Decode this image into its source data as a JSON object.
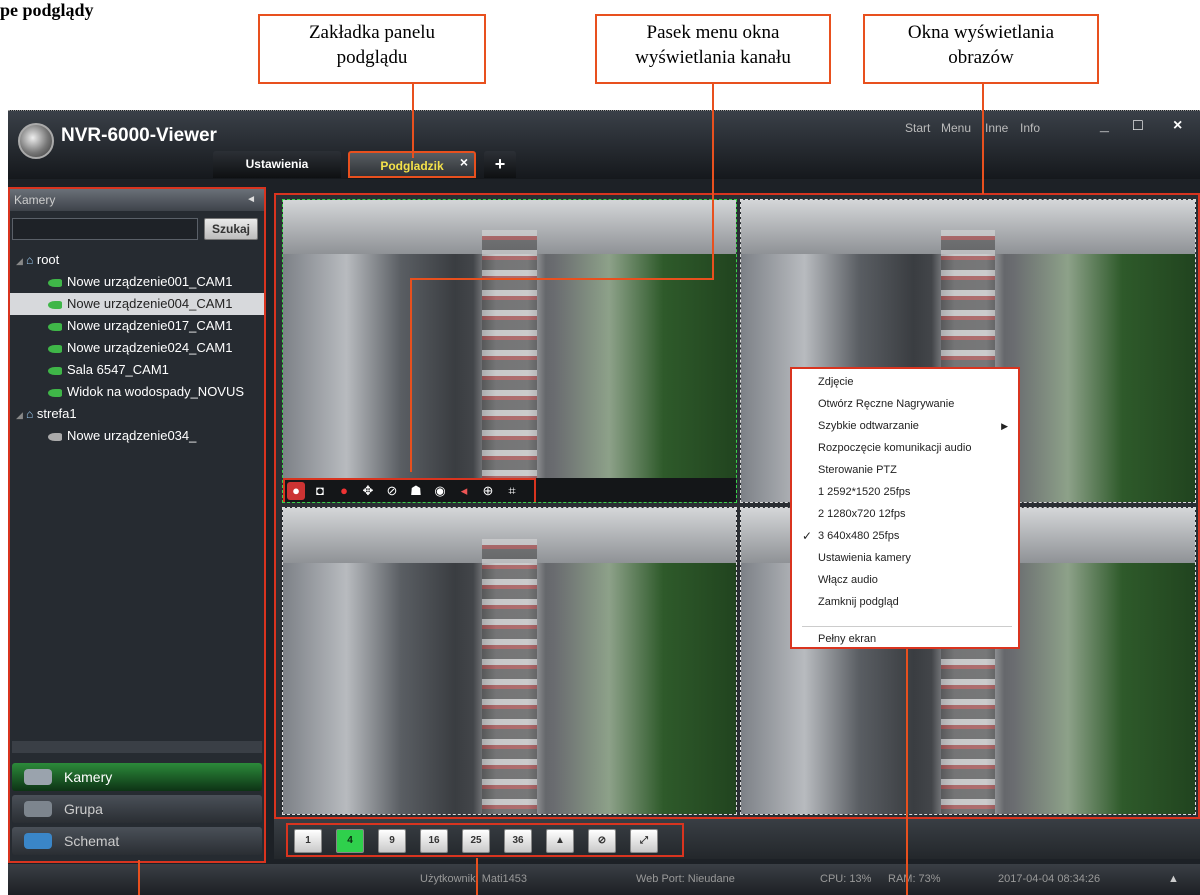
{
  "heading": "pe podglądy",
  "callouts": {
    "tab_panel": [
      "Zakładka panelu",
      "podglądu"
    ],
    "menu_bar": [
      "Pasek menu okna",
      "wyświetlania kanału"
    ],
    "display_windows": [
      "Okna wyświetlania",
      "obrazów"
    ]
  },
  "app": {
    "title": "NVR-6000-Viewer",
    "top_menu": [
      "Start",
      "Menu",
      "Inne",
      "Info"
    ],
    "window_buttons": [
      "_",
      "□",
      "×"
    ],
    "tabs": [
      {
        "label": "Ustawienia",
        "active": false
      },
      {
        "label": "Podgladzik",
        "active": true,
        "close": "×"
      }
    ],
    "add_tab": "+"
  },
  "sidebar": {
    "header": "Kamery",
    "collapse_icon": "◄",
    "search": {
      "value": "",
      "button": "Szukaj"
    },
    "tree": [
      {
        "label": "root",
        "type": "group"
      },
      {
        "label": "Nowe urządzenie001_CAM1",
        "type": "camera",
        "online": true,
        "selected": false
      },
      {
        "label": "Nowe urządzenie004_CAM1",
        "type": "camera",
        "online": true,
        "selected": true
      },
      {
        "label": "Nowe urządzenie017_CAM1",
        "type": "camera",
        "online": true,
        "selected": false
      },
      {
        "label": "Nowe urządzenie024_CAM1",
        "type": "camera",
        "online": true,
        "selected": false
      },
      {
        "label": "Sala 6547_CAM1",
        "type": "camera",
        "online": true,
        "selected": false
      },
      {
        "label": "Widok na wodospady_NOVUS",
        "type": "camera",
        "online": true,
        "selected": false
      },
      {
        "label": "strefa1",
        "type": "group"
      },
      {
        "label": "Nowe urządzenie034_",
        "type": "camera",
        "online": false,
        "selected": false
      }
    ],
    "nav": [
      {
        "label": "Kamery",
        "active": true
      },
      {
        "label": "Grupa",
        "active": false
      },
      {
        "label": "Schemat",
        "active": false
      }
    ]
  },
  "channel_toolbar_icons": [
    "record-icon",
    "snapshot-icon",
    "rec-icon",
    "ptz-icon",
    "stop-icon",
    "talk-icon",
    "camera-icon",
    "audio-icon",
    "zoom-icon",
    "fullscreen-icon"
  ],
  "context_menu": {
    "items": [
      {
        "label": "Zdjęcie"
      },
      {
        "label": "Otwórz Ręczne Nagrywanie"
      },
      {
        "label": "Szybkie odtwarzanie",
        "submenu": true
      },
      {
        "label": "Rozpoczęcie komunikacji audio"
      },
      {
        "label": "Sterowanie PTZ"
      },
      {
        "label": "1 2592*1520 25fps"
      },
      {
        "label": "2 1280x720 12fps"
      },
      {
        "label": "3 640x480 25fps",
        "checked": true
      },
      {
        "label": "Ustawienia kamery"
      },
      {
        "label": "Włącz audio"
      },
      {
        "label": "Zamknij podgląd"
      },
      {
        "label": "Pełny ekran"
      }
    ]
  },
  "layout_buttons": [
    {
      "label": "1",
      "active": false
    },
    {
      "label": "4",
      "active": true
    },
    {
      "label": "9",
      "active": false
    },
    {
      "label": "16",
      "active": false
    },
    {
      "label": "25",
      "active": false
    },
    {
      "label": "36",
      "active": false
    },
    {
      "label": "▲",
      "active": false
    },
    {
      "label": "⊘",
      "active": false
    },
    {
      "label": "⤢",
      "active": false
    }
  ],
  "status": {
    "user": "Użytkownik: Mati1453",
    "web_port": "Web Port: Nieudane",
    "cpu": "CPU: 13%",
    "ram": "RAM: 73%",
    "datetime": "2017-04-04 08:34:26",
    "tray_icon": "▲"
  }
}
